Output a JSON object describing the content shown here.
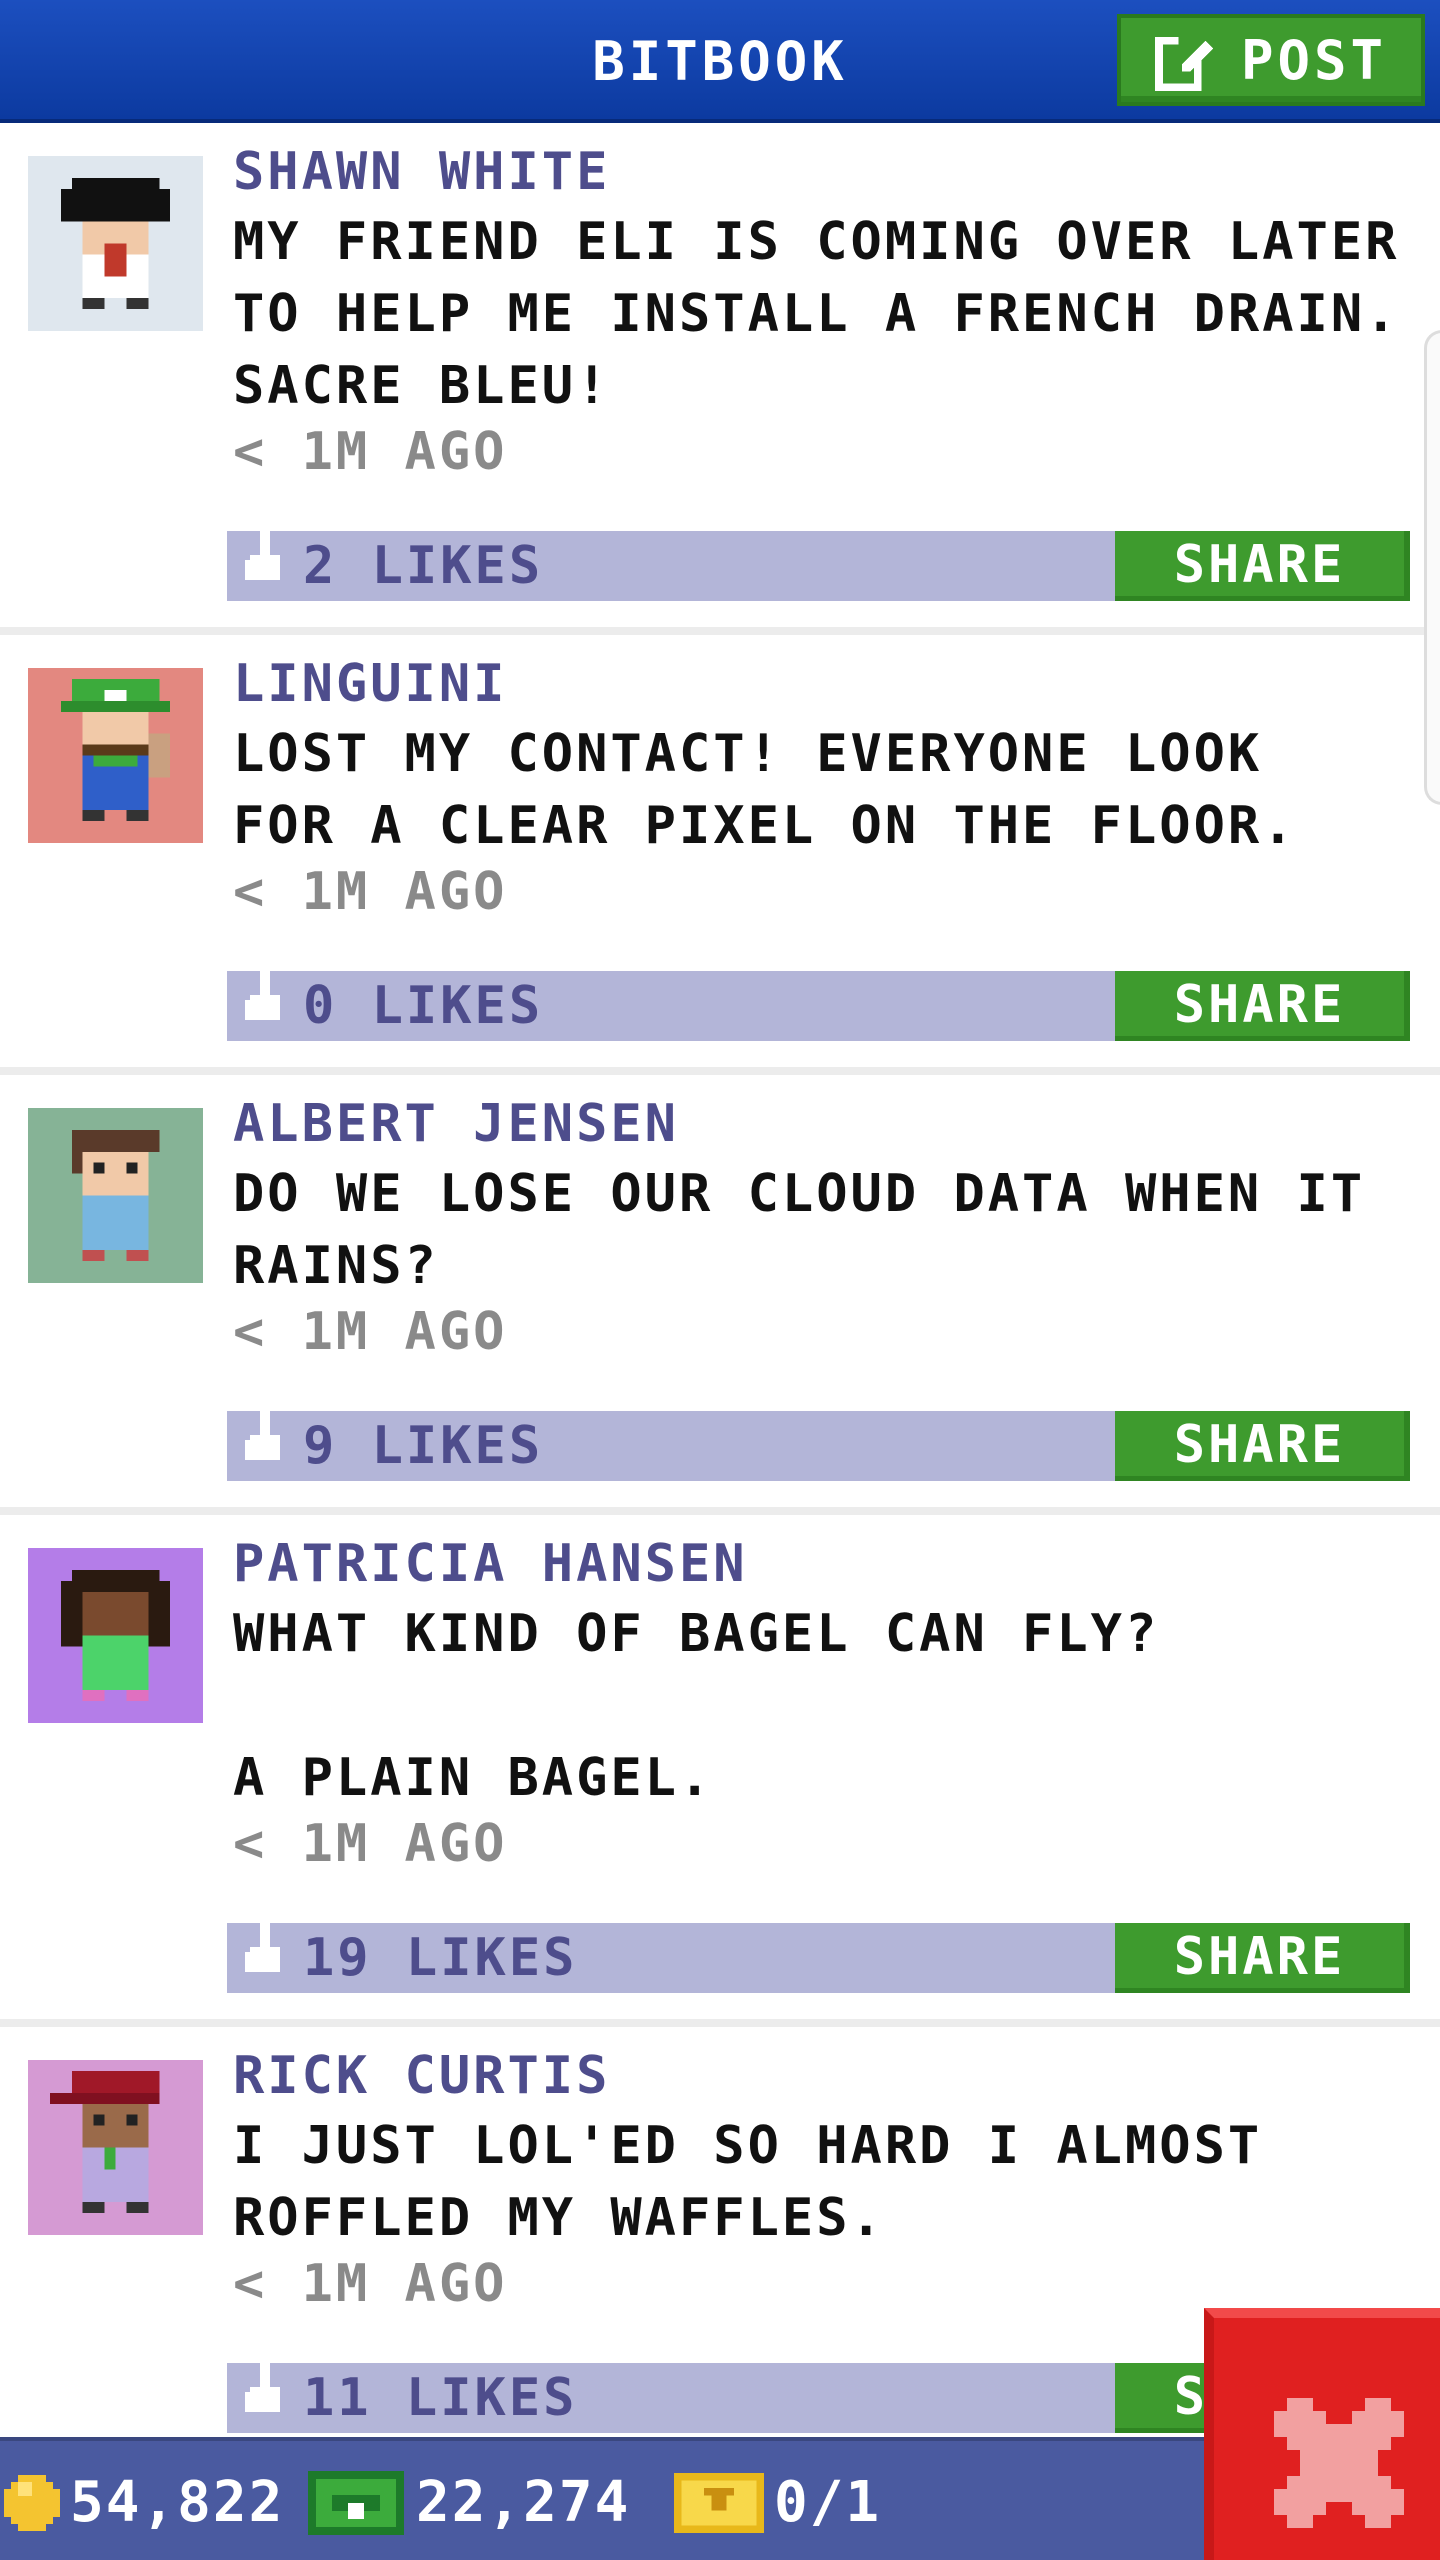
{
  "header": {
    "title": "BITBOOK",
    "post_label": "POST"
  },
  "posts": [
    {
      "name": "SHAWN WHITE",
      "text": "MY FRIEND ELI IS COMING OVER LATER\nTO HELP ME INSTALL A FRENCH DRAIN.\nSACRE BLEU!",
      "time": "< 1M AGO",
      "likes": "2 LIKES",
      "share": "SHARE",
      "avatar_bg": "#dfe7ee"
    },
    {
      "name": "LINGUINI",
      "text": "LOST MY CONTACT! EVERYONE LOOK\nFOR A CLEAR PIXEL ON THE FLOOR.",
      "time": "< 1M AGO",
      "likes": "0 LIKES",
      "share": "SHARE",
      "avatar_bg": "#e38880"
    },
    {
      "name": "ALBERT JENSEN",
      "text": "DO WE LOSE OUR CLOUD DATA WHEN IT\nRAINS?",
      "time": "< 1M AGO",
      "likes": "9 LIKES",
      "share": "SHARE",
      "avatar_bg": "#86b396"
    },
    {
      "name": "PATRICIA HANSEN",
      "text": "WHAT KIND OF BAGEL CAN FLY?\n\nA PLAIN BAGEL.",
      "time": "< 1M AGO",
      "likes": "19 LIKES",
      "share": "SHARE",
      "avatar_bg": "#b47de8"
    },
    {
      "name": "RICK CURTIS",
      "text": "I JUST LOL'ED SO HARD I ALMOST\nROFFLED MY WAFFLES.",
      "time": "< 1M AGO",
      "likes": "11 LIKES",
      "share": "SHARE",
      "avatar_bg": "#d59ad3"
    }
  ],
  "status_bar": {
    "coins": "54,822",
    "bux": "22,274",
    "tickets": "0/1"
  },
  "icons": {
    "post": "edit-icon",
    "like": "thumbs-up-icon",
    "coin": "coin-icon",
    "bux": "bux-icon",
    "ticket": "ticket-icon",
    "close": "close-icon"
  },
  "colors": {
    "header_blue": "#0c3aa0",
    "accent_green": "#3e9b2e",
    "like_bar": "#b3b5d8",
    "name_purple": "#4e4d8c",
    "bottom_bar": "#4a5aa0",
    "close_red": "#e02020"
  }
}
